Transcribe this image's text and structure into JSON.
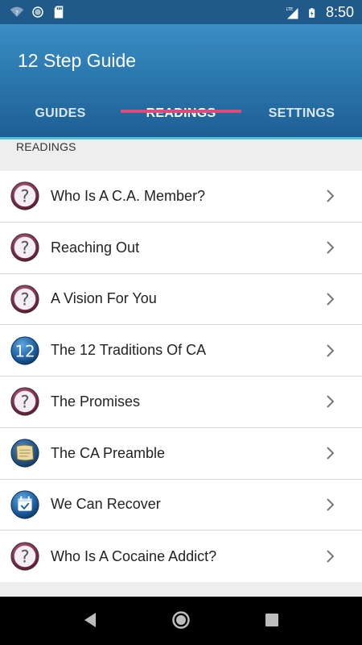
{
  "status_bar": {
    "time": "8:50",
    "network": "LTE",
    "icons": [
      "wifi-unknown-icon",
      "sync-icon",
      "sd-card-icon",
      "lte-signal-icon",
      "battery-charging-icon"
    ]
  },
  "app": {
    "title": "12 Step Guide",
    "brand_color": "#2a76ad",
    "accent_color": "#e04a7b"
  },
  "tabs": [
    {
      "label": "GUIDES",
      "active": false
    },
    {
      "label": "READINGS",
      "active": true
    },
    {
      "label": "SETTINGS",
      "active": false
    }
  ],
  "section_header": "READINGS",
  "readings": [
    {
      "label": "Who Is A C.A. Member?",
      "icon": "question-icon"
    },
    {
      "label": "Reaching Out",
      "icon": "question-icon"
    },
    {
      "label": "A Vision For You",
      "icon": "question-icon"
    },
    {
      "label": "The 12 Traditions Of CA",
      "icon": "twelve-badge-icon",
      "badge_text": "12"
    },
    {
      "label": "The Promises",
      "icon": "question-icon"
    },
    {
      "label": "The CA Preamble",
      "icon": "scroll-icon"
    },
    {
      "label": "We Can Recover",
      "icon": "calendar-check-icon"
    },
    {
      "label": "Who Is A Cocaine Addict?",
      "icon": "question-icon"
    }
  ],
  "nav_bar": {
    "icons": [
      "back-icon",
      "home-icon",
      "recents-icon"
    ]
  }
}
